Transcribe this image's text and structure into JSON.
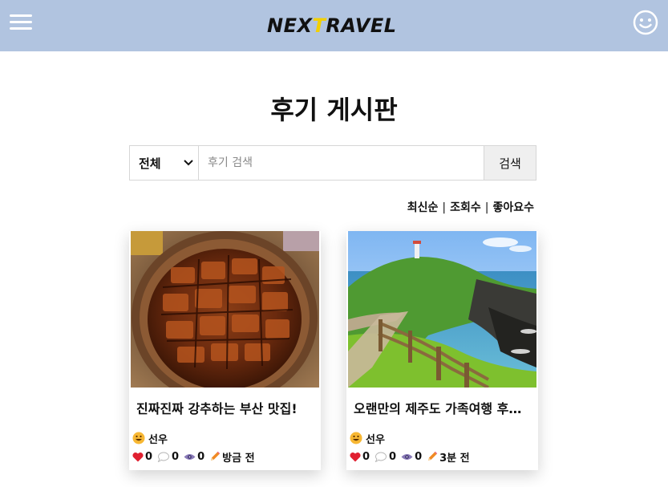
{
  "header": {
    "logo_part1": "NEX",
    "logo_highlight": "T",
    "logo_part2": "RAVEL",
    "menu_icon": "hamburger-menu-icon",
    "profile_icon": "smiley-face-icon",
    "background_color": "#b1c4e0",
    "logo_highlight_color": "#f2d000"
  },
  "page": {
    "title": "후기 게시판"
  },
  "search": {
    "category_selected": "전체",
    "placeholder": "후기 검색",
    "value": "",
    "button_label": "검색"
  },
  "sort": {
    "latest": "최신순",
    "views": "조회수",
    "likes": "좋아요수",
    "separator": "|"
  },
  "posts": [
    {
      "title": "진짜진짜 강추하는 부산 맛집!",
      "author": "선우",
      "likes": "0",
      "comments": "0",
      "views": "0",
      "time": "방금 전",
      "image": "grilled-eel-rice-bowl-photo"
    },
    {
      "title": "오랜만의 제주도 가족여행 후…",
      "author": "선우",
      "likes": "0",
      "comments": "0",
      "views": "0",
      "time": "3분 전",
      "image": "jeju-coastal-trail-photo"
    }
  ]
}
